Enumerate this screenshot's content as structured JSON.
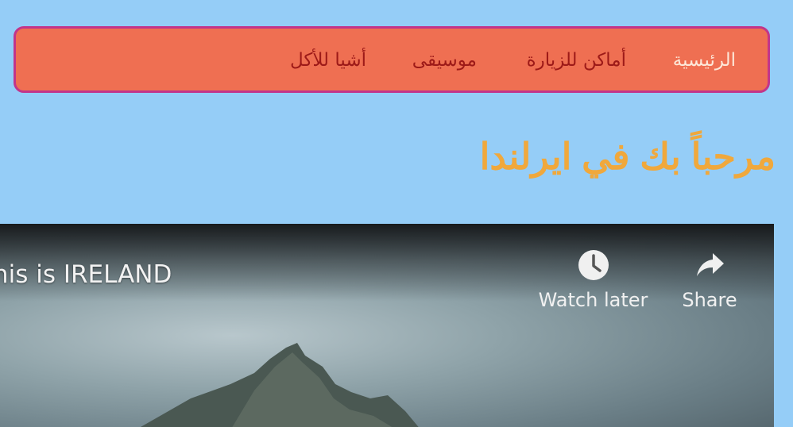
{
  "nav": {
    "items": [
      {
        "label": "الرئيسية",
        "active": true
      },
      {
        "label": "أماكن للزيارة",
        "active": false
      },
      {
        "label": "موسيقى",
        "active": false
      },
      {
        "label": "أشيا للأكل",
        "active": false
      }
    ]
  },
  "main": {
    "title": "مرحباً بك في ايرلندا"
  },
  "video": {
    "title": "This is IRELAND",
    "actions": {
      "watch_later": {
        "label": "Watch later",
        "icon": "clock-icon"
      },
      "share": {
        "label": "Share",
        "icon": "share-arrow-icon"
      }
    }
  },
  "colors": {
    "page_background": "#95cdf7",
    "nav_background": "#ef6f52",
    "nav_border": "#c2358a",
    "nav_text": "#9d1a18",
    "nav_active_text": "#fde7d8",
    "title_color": "#f0a83c"
  }
}
